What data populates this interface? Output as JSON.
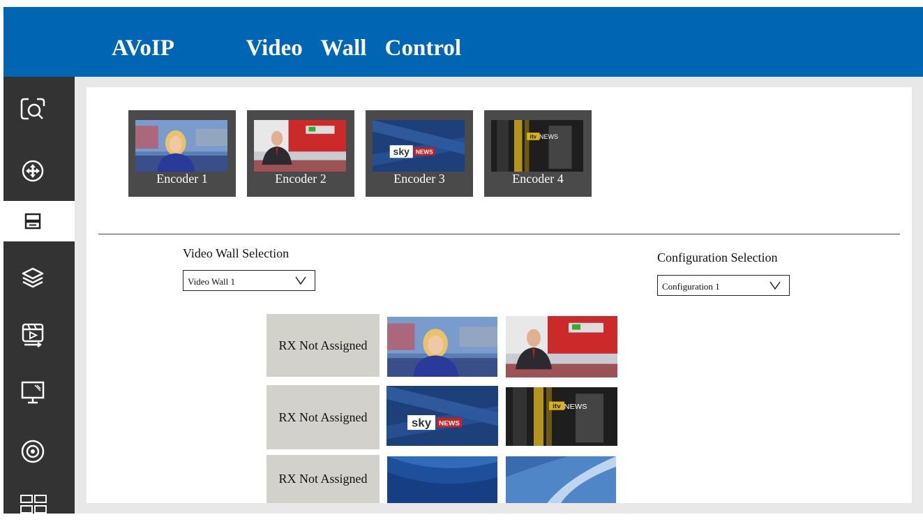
{
  "header": {
    "title": "AVoIP    Video Wall Control"
  },
  "sidebar": {
    "items": [
      {
        "name": "search-icon"
      },
      {
        "name": "add-icon"
      },
      {
        "name": "video-wall-icon",
        "active": true
      },
      {
        "name": "layers-icon"
      },
      {
        "name": "media-play-icon"
      },
      {
        "name": "display-icon"
      },
      {
        "name": "target-icon"
      },
      {
        "name": "grid-icon"
      }
    ]
  },
  "encoders": [
    {
      "label": "Encoder 1",
      "scene": "anchor-woman"
    },
    {
      "label": "Encoder 2",
      "scene": "anchor-man"
    },
    {
      "label": "Encoder 3",
      "scene": "sky-news"
    },
    {
      "label": "Encoder 4",
      "scene": "itv-news"
    }
  ],
  "video_wall_selection": {
    "label": "Video Wall  Selection",
    "value": "Video Wall 1"
  },
  "configuration_selection": {
    "label": "Configuration Selection",
    "value": "Configuration 1"
  },
  "wall": {
    "rows": [
      {
        "rx_label": "RX Not Assigned",
        "tiles": [
          "anchor-woman",
          "anchor-man"
        ]
      },
      {
        "rx_label": "RX Not Assigned",
        "tiles": [
          "sky-news",
          "itv-news"
        ]
      },
      {
        "rx_label": "RX Not Assigned",
        "tiles": [
          "blue-studio-left",
          "blue-studio-right"
        ]
      }
    ]
  },
  "colors": {
    "header": "#0066b3",
    "sidebar": "#333333",
    "encoder_bg": "#4a4a4a",
    "rx_bg": "#d2d1cc"
  }
}
